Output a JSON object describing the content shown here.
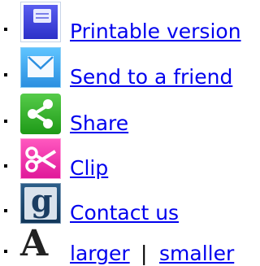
{
  "tools": {
    "printable": {
      "icon": "printer-icon",
      "label": "Printable version"
    },
    "send": {
      "icon": "envelope-icon",
      "label": "Send to a friend"
    },
    "share": {
      "icon": "share-icon",
      "label": "Share"
    },
    "clip": {
      "icon": "scissors-icon",
      "label": "Clip"
    },
    "contact": {
      "icon": "contact-icon",
      "label": "Contact us"
    },
    "text_size": {
      "icon": "text-size-icon",
      "icon_glyph": "A",
      "larger_label": "larger",
      "separator": "|",
      "smaller_label": "smaller"
    }
  }
}
